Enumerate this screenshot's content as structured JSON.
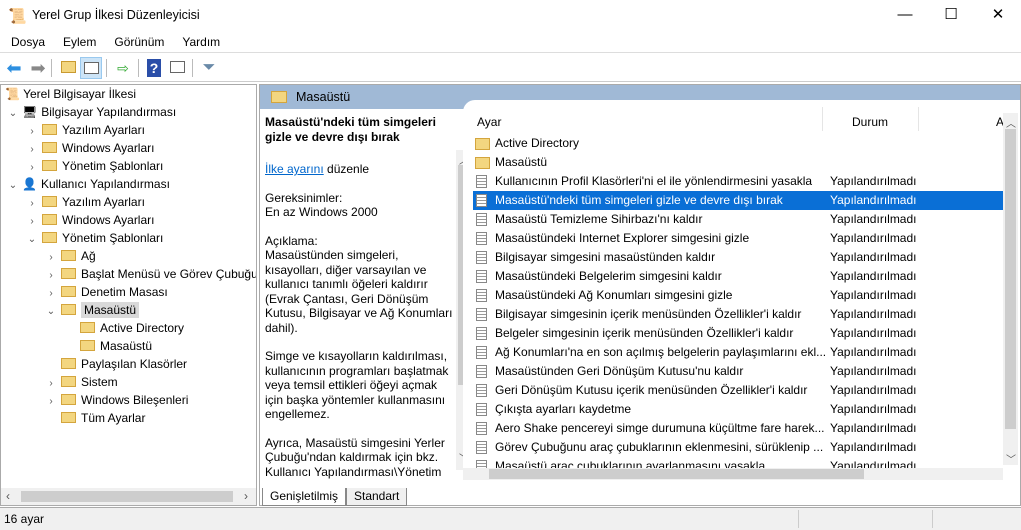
{
  "window": {
    "title": "Yerel Grup İlkesi Düzenleyicisi",
    "minimize": "—",
    "maximize": "☐",
    "close": "✕"
  },
  "menu": [
    "Dosya",
    "Eylem",
    "Görünüm",
    "Yardım"
  ],
  "toolbar": {
    "icons": [
      "back-arrow-icon",
      "forward-arrow-icon",
      "up-folder-icon",
      "show-hide-tree-icon",
      "export-list-icon",
      "help-icon",
      "show-action-pane-icon",
      "filter-icon"
    ],
    "help_glyph": "?"
  },
  "tree": {
    "root": "Yerel Bilgisayar İlkesi",
    "items": [
      {
        "label": "Bilgisayar Yapılandırması",
        "level": 1,
        "state": "expanded"
      },
      {
        "label": "Yazılım Ayarları",
        "level": 2,
        "state": "collapsed"
      },
      {
        "label": "Windows Ayarları",
        "level": 2,
        "state": "collapsed"
      },
      {
        "label": "Yönetim Şablonları",
        "level": 2,
        "state": "collapsed"
      },
      {
        "label": "Kullanıcı Yapılandırması",
        "level": 1,
        "state": "expanded"
      },
      {
        "label": "Yazılım Ayarları",
        "level": 2,
        "state": "collapsed"
      },
      {
        "label": "Windows Ayarları",
        "level": 2,
        "state": "collapsed"
      },
      {
        "label": "Yönetim Şablonları",
        "level": 2,
        "state": "expanded"
      },
      {
        "label": "Ağ",
        "level": 3,
        "state": "collapsed"
      },
      {
        "label": "Başlat Menüsü ve Görev Çubuğu",
        "level": 3,
        "state": "collapsed"
      },
      {
        "label": "Denetim Masası",
        "level": 3,
        "state": "collapsed"
      },
      {
        "label": "Masaüstü",
        "level": 3,
        "state": "expanded",
        "selected": true
      },
      {
        "label": "Active Directory",
        "level": 4,
        "state": "none"
      },
      {
        "label": "Masaüstü",
        "level": 4,
        "state": "none"
      },
      {
        "label": "Paylaşılan Klasörler",
        "level": 3,
        "state": "none"
      },
      {
        "label": "Sistem",
        "level": 3,
        "state": "collapsed"
      },
      {
        "label": "Windows Bileşenleri",
        "level": 3,
        "state": "collapsed"
      },
      {
        "label": "Tüm Ayarlar",
        "level": 3,
        "state": "none",
        "icon": "all-settings-icon"
      }
    ]
  },
  "header": {
    "title": "Masaüstü"
  },
  "description": {
    "title": "Masaüstü'ndeki tüm simgeleri gizle ve devre dışı bırak",
    "link": "İlke ayarını",
    "link_suffix": " düzenle",
    "req_label": "Gereksinimler:",
    "req_value": "En az Windows 2000",
    "desc_label": "Açıklama:",
    "p1": "Masaüstünden simgeleri, kısayolları, diğer varsayılan ve kullanıcı tanımlı öğeleri kaldırır (Evrak Çantası, Geri Dönüşüm Kutusu, Bilgisayar ve Ağ Konumları dahil).",
    "p2": "Simge ve kısayolların kaldırılması, kullanıcının programları başlatmak veya temsil ettikleri öğeyi açmak için başka yöntemler kullanmasını engellemez.",
    "p3": "Ayrıca, Masaüstü simgesini Yerler Çubuğu'ndan kaldırmak için bkz. Kullanıcı Yapılandırması\\Yönetim"
  },
  "list": {
    "columns": [
      "Ayar",
      "Durum",
      "A"
    ],
    "folders": [
      "Active Directory",
      "Masaüstü"
    ],
    "rows": [
      {
        "name": "Kullanıcının Profil Klasörleri'ni el ile yönlendirmesini yasakla",
        "state": "Yapılandırılmadı"
      },
      {
        "name": "Masaüstü'ndeki tüm simgeleri gizle ve devre dışı bırak",
        "state": "Yapılandırılmadı",
        "selected": true
      },
      {
        "name": "Masaüstü Temizleme Sihirbazı'nı kaldır",
        "state": "Yapılandırılmadı"
      },
      {
        "name": "Masaüstündeki Internet Explorer simgesini gizle",
        "state": "Yapılandırılmadı"
      },
      {
        "name": "Bilgisayar simgesini masaüstünden kaldır",
        "state": "Yapılandırılmadı"
      },
      {
        "name": "Masaüstündeki Belgelerim simgesini kaldır",
        "state": "Yapılandırılmadı"
      },
      {
        "name": "Masaüstündeki Ağ Konumları simgesini gizle",
        "state": "Yapılandırılmadı"
      },
      {
        "name": "Bilgisayar simgesinin içerik menüsünden Özellikler'i kaldır",
        "state": "Yapılandırılmadı"
      },
      {
        "name": "Belgeler simgesinin içerik menüsünden Özellikler'i kaldır",
        "state": "Yapılandırılmadı"
      },
      {
        "name": "Ağ Konumları'na en son açılmış belgelerin paylaşımlarını ekl...",
        "state": "Yapılandırılmadı"
      },
      {
        "name": "Masaüstünden Geri Dönüşüm Kutusu'nu kaldır",
        "state": "Yapılandırılmadı"
      },
      {
        "name": "Geri Dönüşüm Kutusu içerik menüsünden Özellikler'i kaldır",
        "state": "Yapılandırılmadı"
      },
      {
        "name": "Çıkışta ayarları kaydetme",
        "state": "Yapılandırılmadı"
      },
      {
        "name": "Aero Shake pencereyi simge durumuna küçültme fare harek...",
        "state": "Yapılandırılmadı"
      },
      {
        "name": "Görev Çubuğunu araç çubuklarının eklenmesini, sürüklenip ...",
        "state": "Yapılandırılmadı"
      },
      {
        "name": "Masaüstü araç çubuklarının ayarlanmasını yasakla",
        "state": "Yapılandırılmadı"
      }
    ]
  },
  "tabs": [
    "Genişletilmiş",
    "Standart"
  ],
  "status": {
    "text": "16 ayar"
  },
  "colors": {
    "selection": "#0a6fd6",
    "header_bar": "#a0b9d6",
    "link": "#0066cc"
  }
}
